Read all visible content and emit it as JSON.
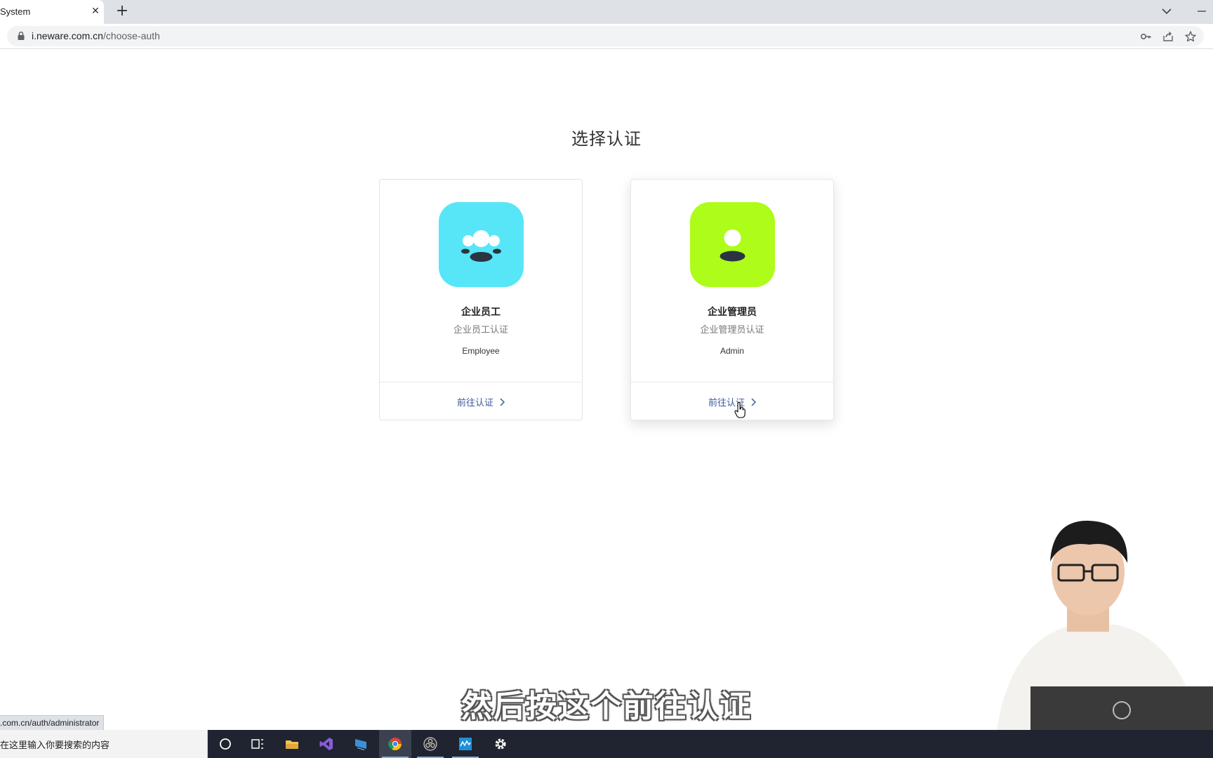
{
  "browser": {
    "tab_title": "System",
    "tab_close": "✕",
    "new_tab": "+",
    "url_host": "i.neware.com.cn",
    "url_path": "/choose-auth",
    "status_url": ".com.cn/auth/administrator"
  },
  "page": {
    "title": "选择认证",
    "cards": [
      {
        "name": "企业员工",
        "subtitle": "企业员工认证",
        "english": "Employee",
        "link": "前往认证",
        "icon": "group-users-icon",
        "icon_color": "#57e6f7"
      },
      {
        "name": "企业管理员",
        "subtitle": "企业管理员认证",
        "english": "Admin",
        "link": "前往认证",
        "icon": "single-user-icon",
        "icon_color": "#aefc1a"
      }
    ]
  },
  "overlay": {
    "subtitle": "然后按这个前往认证"
  },
  "taskbar": {
    "search_placeholder": "在这里输入你要搜索的内容",
    "apps": [
      "cortana-icon",
      "task-view-icon",
      "file-explorer-icon",
      "visual-studio-icon",
      "app-icon",
      "chrome-icon",
      "obs-icon",
      "monitor-app-icon",
      "settings-icon"
    ]
  }
}
